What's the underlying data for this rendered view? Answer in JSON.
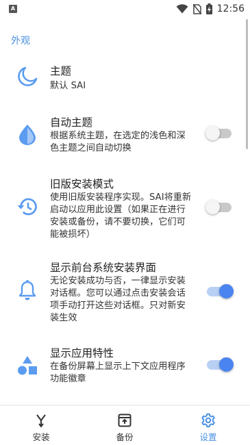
{
  "status_bar": {
    "app_badge": "A",
    "time": "12:56",
    "icons": [
      "wifi-icon",
      "no-sim-icon",
      "battery-charging-icon"
    ]
  },
  "section": {
    "header": "外观"
  },
  "settings": [
    {
      "title": "主题",
      "desc": "默认 SAI",
      "icon": "moon-icon"
    },
    {
      "title": "自动主题",
      "desc": "根据系统主题，在选定的浅色和深色主题之间自动切换",
      "icon": "drop-icon",
      "toggle": false
    },
    {
      "title": "旧版安装模式",
      "desc": "使用旧版安装程序实现。SAI将重新启动以应用此设置（如果正在进行安装或备份，请不要切换，它们可能被损坏）",
      "icon": "history-icon",
      "toggle": false
    },
    {
      "title": "显示前台系统安装界面",
      "desc": "无论安装成功与否，一律显示安装对话框。您可以通过点击安装会话项手动打开这些对话框。只对新安装生效",
      "icon": "bell-icon",
      "toggle": true
    },
    {
      "title": "显示应用特性",
      "desc": "在备份屏幕上显示上下文应用程序功能徽章",
      "icon": "shapes-icon",
      "toggle": true
    }
  ],
  "bottom_nav": [
    {
      "label": "安装",
      "icon": "install-icon",
      "active": false
    },
    {
      "label": "备份",
      "icon": "backup-icon",
      "active": false
    },
    {
      "label": "设置",
      "icon": "settings-icon",
      "active": true
    }
  ],
  "colors": {
    "accent": "#4a90e2",
    "toggle_on": "#4a84f0",
    "icon": "#5b9cf0"
  }
}
